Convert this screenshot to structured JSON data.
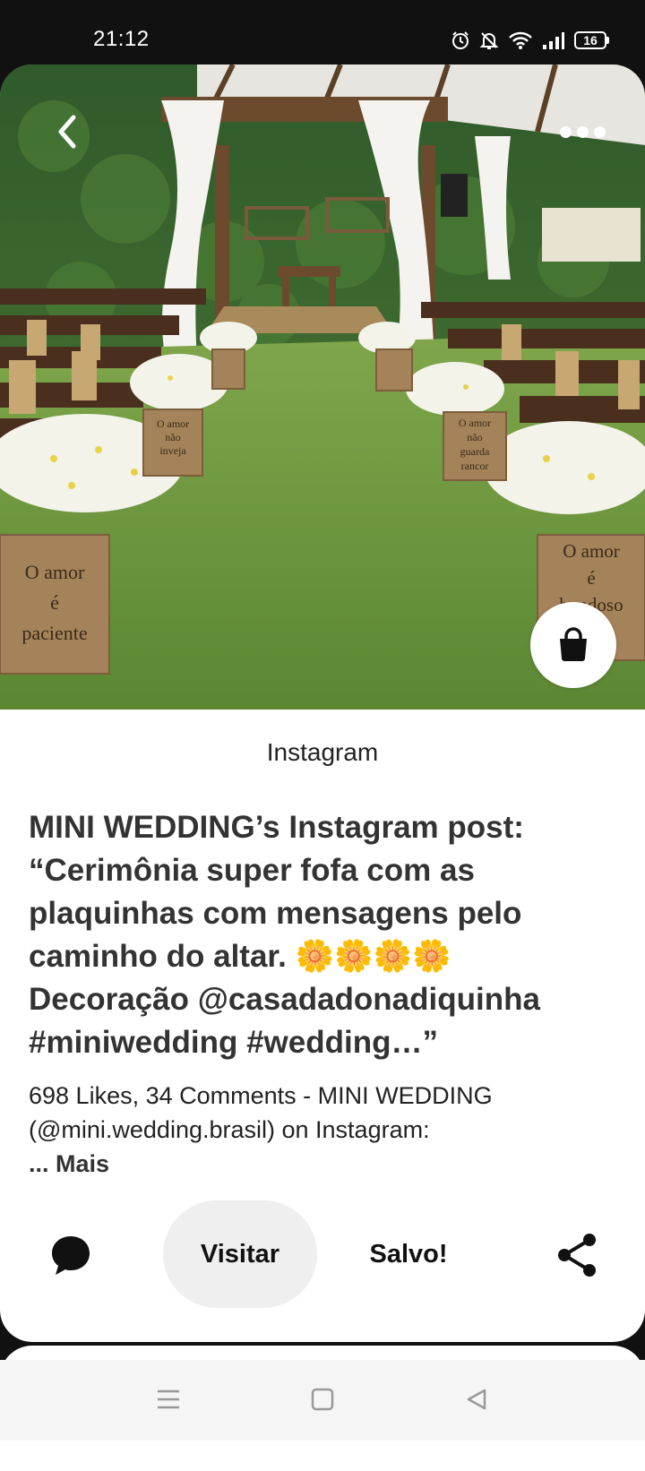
{
  "status_bar": {
    "time": "21:12",
    "battery": "16",
    "icons": [
      "alarm-icon",
      "mute-icon",
      "wifi-icon",
      "signal-icon",
      "battery-icon"
    ]
  },
  "hero": {
    "image_subject": "outdoor wedding ceremony",
    "signs": {
      "left_front": [
        "O amor",
        "é",
        "paciente"
      ],
      "left_mid": [
        "O amor",
        "não",
        "inveja"
      ],
      "right_mid": [
        "O amor",
        "não",
        "guarda",
        "rancor"
      ],
      "right_front": [
        "O amor",
        "é",
        "bondoso"
      ]
    }
  },
  "pin": {
    "source": "Instagram",
    "title": "MINI WEDDING’s Instagram post: “Cerimônia super fofa com as plaquinhas com mensagens pelo caminho do altar. 🌼🌼🌼🌼 Decoração @casadadonadiquinha #miniwedding #wedding…”",
    "description": "698 Likes, 34 Comments - MINI WEDDING (@mini.wedding.brasil) on Instagram:",
    "more_label": "... Mais"
  },
  "actions": {
    "visit_label": "Visitar",
    "saved_label": "Salvo!"
  },
  "colors": {
    "background": "#111111",
    "card": "#ffffff",
    "visit_button_bg": "#efefef",
    "text": "#333333"
  }
}
